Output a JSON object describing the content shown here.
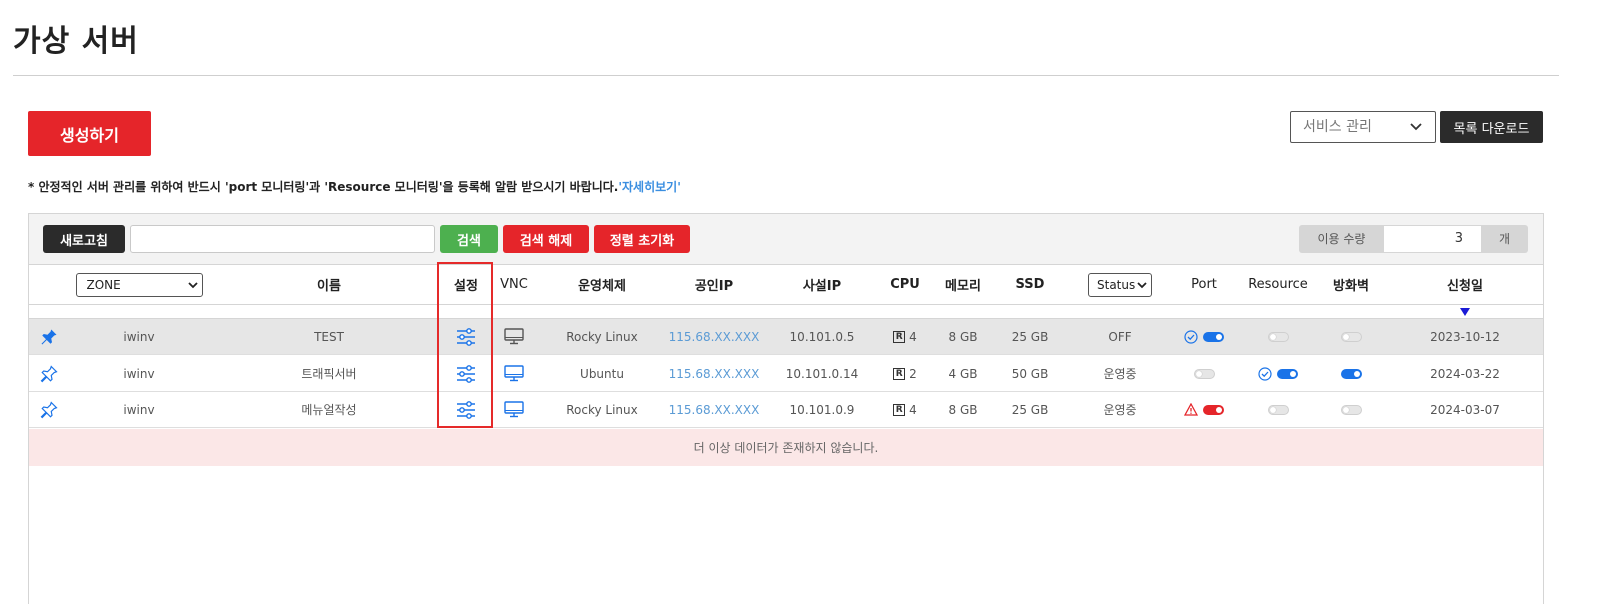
{
  "page": {
    "title": "가상 서버"
  },
  "actions": {
    "create_label": "생성하기",
    "service_select": "서비스 관리",
    "download_label": "목록 다운로드"
  },
  "notice": {
    "text": "* 안정적인 서버 관리를 위하여 반드시 'port 모니터링'과 'Resource 모니터링'을 등록해 알람 받으시기 바랍니다.",
    "link": "'자세히보기'"
  },
  "toolbar": {
    "refresh": "새로고침",
    "search_value": "",
    "search": "검색",
    "clear": "검색 해제",
    "reset": "정렬 초기화",
    "usage_label": "이용 수량",
    "usage_value": "3",
    "usage_unit": "개"
  },
  "columns": {
    "zone": "ZONE",
    "name": "이름",
    "settings": "설정",
    "vnc": "VNC",
    "os": "운영체제",
    "public_ip": "공인IP",
    "private_ip": "사설IP",
    "cpu": "CPU",
    "memory": "메모리",
    "ssd": "SSD",
    "status": "Status",
    "port": "Port",
    "resource": "Resource",
    "firewall": "방화벽",
    "date": "신청일"
  },
  "rows": [
    {
      "zone": "iwinv",
      "name": "TEST",
      "os": "Rocky Linux",
      "public_ip": "115.68.XX.XXX",
      "private_ip": "10.101.0.5",
      "cpu": "4",
      "memory": "8 GB",
      "ssd": "25 GB",
      "status": "OFF",
      "date": "2023-10-12"
    },
    {
      "zone": "iwinv",
      "name": "트래픽서버",
      "os": "Ubuntu",
      "public_ip": "115.68.XX.XXX",
      "private_ip": "10.101.0.14",
      "cpu": "2",
      "memory": "4 GB",
      "ssd": "50 GB",
      "status": "운영중",
      "date": "2024-03-22"
    },
    {
      "zone": "iwinv",
      "name": "메뉴얼작성",
      "os": "Rocky Linux",
      "public_ip": "115.68.XX.XXX",
      "private_ip": "10.101.0.9",
      "cpu": "4",
      "memory": "8 GB",
      "ssd": "25 GB",
      "status": "운영중",
      "date": "2024-03-07"
    }
  ],
  "cpu_badge": "R",
  "empty_message": "더 이상 데이터가 존재하지 않습니다.",
  "colors": {
    "accent_red": "#e5252a",
    "search_green": "#4db04f",
    "link_blue": "#3a8ee0",
    "toggle_blue": "#1a73e8"
  }
}
